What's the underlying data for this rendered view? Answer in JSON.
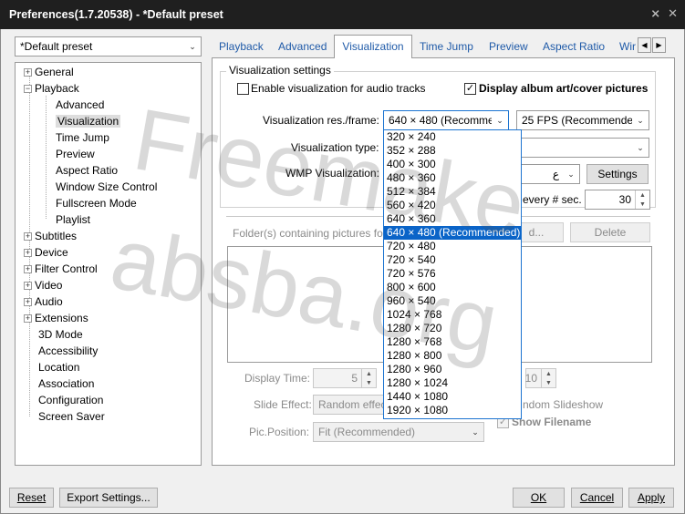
{
  "window": {
    "title": "Preferences(1.7.20538) - *Default preset",
    "controls": [
      "pin-icon",
      "close-icon"
    ]
  },
  "preset_combo": {
    "value": "*Default preset"
  },
  "tree": {
    "items": [
      {
        "label": "General",
        "expander": "+"
      },
      {
        "label": "Playback",
        "expander": "-"
      },
      {
        "label": "Advanced"
      },
      {
        "label": "Visualization",
        "selected": true
      },
      {
        "label": "Time Jump"
      },
      {
        "label": "Preview"
      },
      {
        "label": "Aspect Ratio"
      },
      {
        "label": "Window Size Control"
      },
      {
        "label": "Fullscreen Mode"
      },
      {
        "label": "Playlist"
      },
      {
        "label": "Subtitles",
        "expander": "+"
      },
      {
        "label": "Device",
        "expander": "+"
      },
      {
        "label": "Filter Control",
        "expander": "+"
      },
      {
        "label": "Video",
        "expander": "+"
      },
      {
        "label": "Audio",
        "expander": "+"
      },
      {
        "label": "Extensions",
        "expander": "+"
      },
      {
        "label": "3D Mode"
      },
      {
        "label": "Accessibility"
      },
      {
        "label": "Location"
      },
      {
        "label": "Association"
      },
      {
        "label": "Configuration"
      },
      {
        "label": "Screen Saver"
      }
    ]
  },
  "tabs": [
    {
      "label": "Playback"
    },
    {
      "label": "Advanced"
    },
    {
      "label": "Visualization",
      "active": true
    },
    {
      "label": "Time Jump"
    },
    {
      "label": "Preview"
    },
    {
      "label": "Aspect Ratio"
    },
    {
      "label": "Wir"
    }
  ],
  "visualization": {
    "group_title": "Visualization settings",
    "enable_audio_label": "Enable visualization for audio tracks",
    "enable_audio_checked": false,
    "album_art_label": "Display album art/cover pictures",
    "album_art_checked": true,
    "res_label": "Visualization res./frame:",
    "res_value": "640 × 480 (Recommer",
    "fps_value": "25 FPS (Recommended",
    "type_label": "Visualization type:",
    "wmp_label": "WMP Visualization:",
    "wmp_value_partial": "ع",
    "settings_button": "Settings",
    "every_sec_label": "every # sec.",
    "every_sec_value": "30",
    "folders_label": "Folder(s) containing pictures fo",
    "add_button_partial": "d...",
    "delete_button": "Delete",
    "display_time_label": "Display Time:",
    "display_time_value": "5",
    "second_spin_value": "10",
    "slide_effect_label": "Slide Effect:",
    "slide_effect_value": "Random effec",
    "random_slideshow_label": "ndom Slideshow",
    "show_filename_label": "Show Filename",
    "show_filename_checked": true,
    "pic_position_label": "Pic.Position:",
    "pic_position_value": "Fit (Recommended)"
  },
  "resolution_dropdown": {
    "options": [
      "320 × 240",
      "352 × 288",
      "400 × 300",
      "480 × 360",
      "512 × 384",
      "560 × 420",
      "640 × 360",
      "640 × 480 (Recommended)",
      "720 × 480",
      "720 × 540",
      "720 × 576",
      "800 × 600",
      "960 × 540",
      "1024 × 768",
      "1280 × 720",
      "1280 × 768",
      "1280 × 800",
      "1280 × 960",
      "1280 × 1024",
      "1440 × 1080",
      "1920 × 1080"
    ],
    "selected_index": 7
  },
  "footer": {
    "reset": "Reset",
    "export": "Export Settings...",
    "ok": "OK",
    "cancel": "Cancel",
    "apply": "Apply"
  },
  "watermark": {
    "line1": "Freemake",
    "line2": "absba.org"
  }
}
